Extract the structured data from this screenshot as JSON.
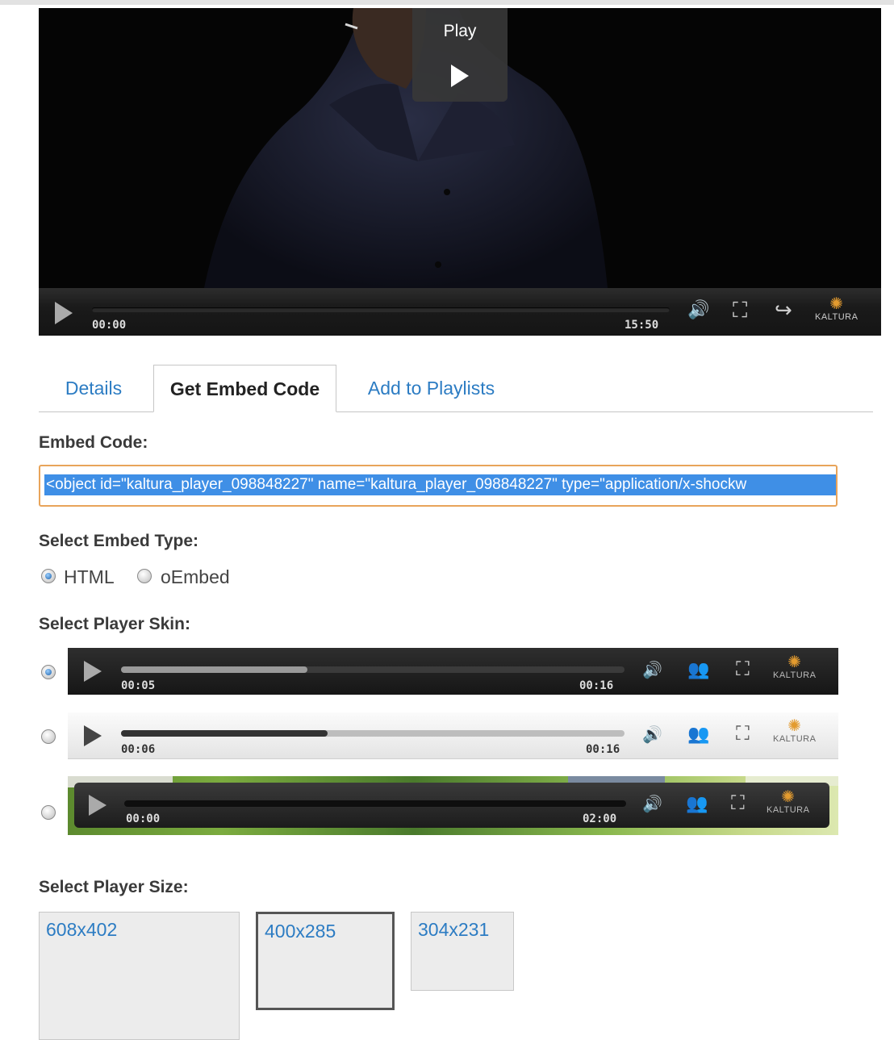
{
  "player": {
    "play_overlay_label": "Play",
    "current_time": "00:00",
    "duration": "15:50",
    "brand": "KALTURA",
    "icons": [
      "play-icon",
      "volume-icon",
      "fullscreen-icon",
      "share-icon",
      "kaltura-logo"
    ]
  },
  "tabs": [
    {
      "label": "Details",
      "active": false
    },
    {
      "label": "Get Embed Code",
      "active": true
    },
    {
      "label": "Add to Playlists",
      "active": false
    }
  ],
  "embed": {
    "label": "Embed Code:",
    "value": "<object id=\"kaltura_player_098848227\" name=\"kaltura_player_098848227\" type=\"application/x-shockw"
  },
  "embed_type": {
    "label": "Select Embed Type:",
    "options": [
      {
        "label": "HTML",
        "selected": true
      },
      {
        "label": "oEmbed",
        "selected": false
      }
    ]
  },
  "skins": {
    "label": "Select Player Skin:",
    "items": [
      {
        "current": "00:05",
        "duration": "00:16",
        "progress": 0.37,
        "brand": "KALTURA",
        "selected": true,
        "theme": "dark"
      },
      {
        "current": "00:06",
        "duration": "00:16",
        "progress": 0.41,
        "brand": "KALTURA",
        "selected": false,
        "theme": "light"
      },
      {
        "current": "00:00",
        "duration": "02:00",
        "progress": 0.0,
        "brand": "KALTURA",
        "selected": false,
        "theme": "overlay"
      }
    ]
  },
  "sizes": {
    "label": "Select Player Size:",
    "options": [
      {
        "label": "608x402",
        "selected": false
      },
      {
        "label": "400x285",
        "selected": true
      },
      {
        "label": "304x231",
        "selected": false
      }
    ]
  },
  "colors": {
    "link": "#2c7cc3",
    "selection": "#3f8fe6",
    "focus_border": "#e8a45a",
    "kaltura_accent": "#e39b2f"
  }
}
